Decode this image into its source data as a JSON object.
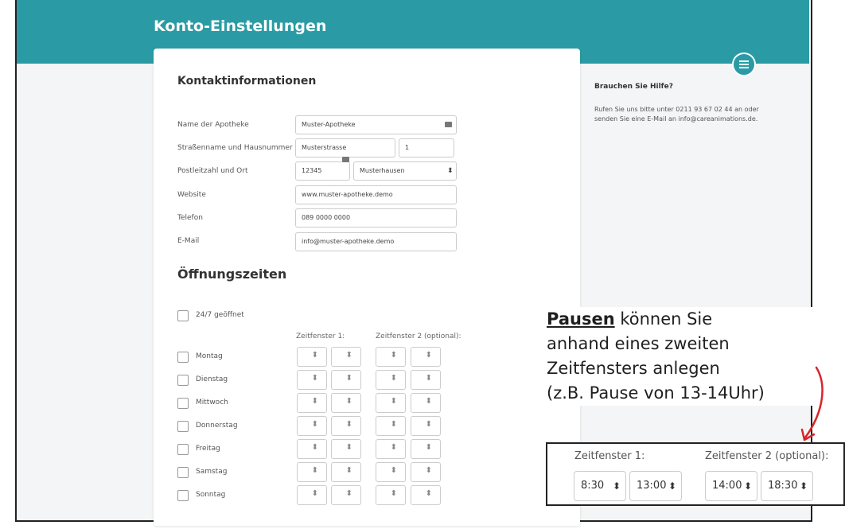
{
  "header": {
    "title": "Konto-Einstellungen"
  },
  "contact": {
    "section_title": "Kontaktinformationen",
    "fields": {
      "name_label": "Name der Apotheke",
      "name_value": "Muster-Apotheke",
      "street_label": "Straßenname und Hausnummer",
      "street_value": "Musterstrasse",
      "number_value": "1",
      "zip_label": "Postleitzahl und Ort",
      "zip_value": "12345",
      "city_value": "Musterhausen",
      "website_label": "Website",
      "website_value": "www.muster-apotheke.demo",
      "phone_label": "Telefon",
      "phone_value": "089 0000 0000",
      "email_label": "E-Mail",
      "email_value": "info@muster-apotheke.demo"
    }
  },
  "hours": {
    "section_title": "Öffnungszeiten",
    "always_open_label": "24/7 geöffnet",
    "window1_label": "Zeitfenster 1:",
    "window2_label": "Zeitfenster 2 (optional):",
    "days": [
      "Montag",
      "Dienstag",
      "Mittwoch",
      "Donnerstag",
      "Freitag",
      "Samstag",
      "Sonntag"
    ]
  },
  "help": {
    "title": "Brauchen Sie Hilfe?",
    "text": "Rufen Sie uns bitte unter 0211 93 67 02 44 an oder senden Sie eine E-Mail an info@careanimations.de."
  },
  "annotation": {
    "bold_word": "Pausen",
    "line1_rest": " können Sie",
    "line2": "anhand eines zweiten",
    "line3": "Zeitfensters anlegen",
    "line4": "(z.B. Pause von 13-14Uhr)"
  },
  "zoom_example": {
    "window1_label": "Zeitfenster 1:",
    "window2_label": "Zeitfenster 2 (optional):",
    "w1_start": "8:30",
    "w1_end": "13:00",
    "w2_start": "14:00",
    "w2_end": "18:30"
  },
  "colors": {
    "brand": "#2a9ba4",
    "annotation_arrow": "#d9252a"
  }
}
